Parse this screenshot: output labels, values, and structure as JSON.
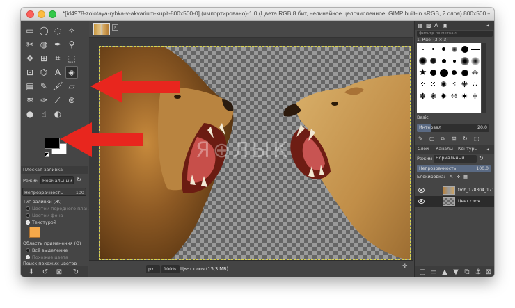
{
  "window": {
    "title": "*[id4978-zolotaya-rybka-v-akvarium-kupit-800x500-0] (импортировано)-1.0 (Цвета RGB 8 бит, нелинейное целочисленное, GIMP built-in sRGB, 2 слоя) 800x500 – GIMP"
  },
  "tool_options": {
    "header": "Плоская заливка",
    "mode_label": "Режим",
    "mode_value": "Нормальный",
    "opacity_label": "Непрозрачность",
    "opacity_value": "100",
    "fill_type_label": "Тип заливки (Ж)",
    "fill_fg": "Цветом переднего плана",
    "fill_bg": "Цветом фона",
    "fill_pattern": "Текстурой",
    "area_label": "Область применения (Ö)",
    "area_selection": "Всё выделение",
    "area_similar": "Похожие цвета",
    "search_similar": "Поиск похожих цветов"
  },
  "colors": {
    "foreground": "#000000",
    "background": "#ffffff",
    "pattern_swatch": "#f6a94a"
  },
  "canvas": {
    "watermark": "Я⊕ЛЫК",
    "unit": "px",
    "zoom": "100%",
    "status": "Цвет слоя (15,3 МБ)"
  },
  "brushes": {
    "filter_placeholder": "фильтр по меткам",
    "brush_name": "1. Pixel (3 × 3)",
    "preset_label": "Basic,",
    "interval_label": "Интервал",
    "interval_value": "20,0",
    "interval_level": 0.2
  },
  "layers": {
    "tabs": [
      "Слои",
      "Каналы",
      "Контуры"
    ],
    "mode_label": "Режим",
    "mode_value": "Нормальный",
    "opacity_label": "Непрозрачность",
    "opacity_value": "100,0",
    "lock_label": "Блокировка:",
    "items": [
      {
        "name": "tmb_178304_171"
      },
      {
        "name": "Цвет слоя"
      }
    ]
  }
}
